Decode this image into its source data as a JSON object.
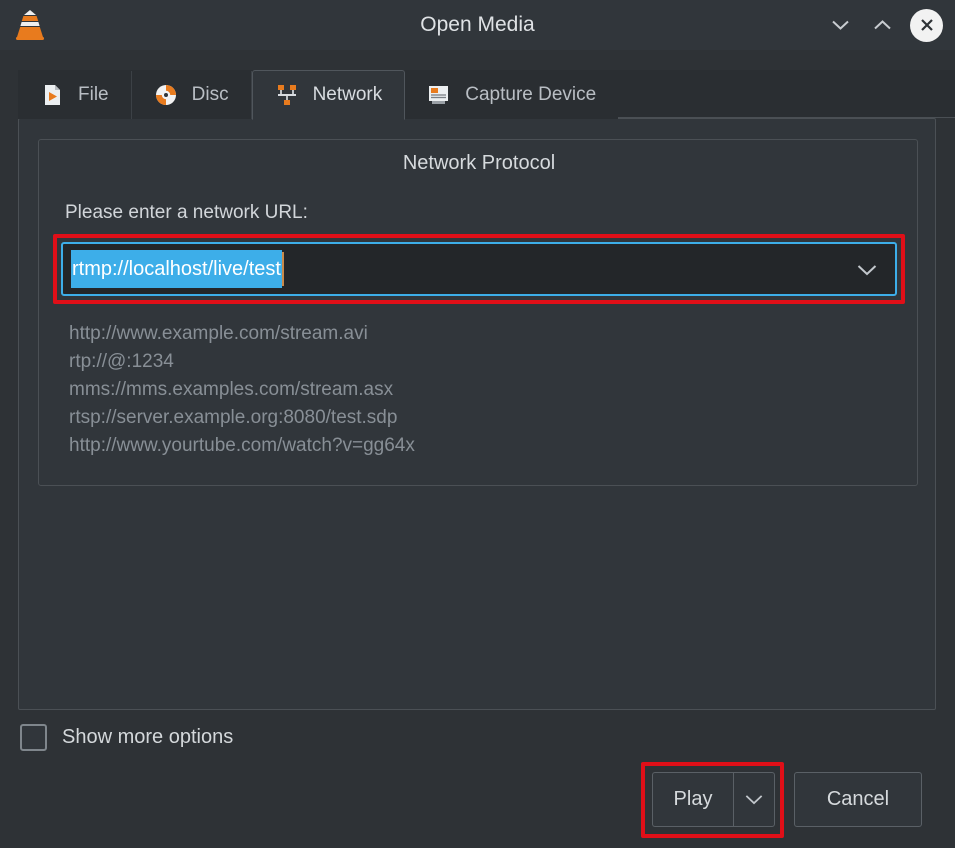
{
  "window": {
    "title": "Open Media",
    "logo_icon": "vlc-cone-icon",
    "controls": {
      "minimize_icon": "chevron-down-icon",
      "maximize_icon": "chevron-up-icon",
      "close_icon": "close-x-icon"
    }
  },
  "tabs": [
    {
      "label": "File",
      "icon": "file-play-icon",
      "active": false
    },
    {
      "label": "Disc",
      "icon": "disc-icon",
      "active": false
    },
    {
      "label": "Network",
      "icon": "network-topology-icon",
      "active": true
    },
    {
      "label": "Capture Device",
      "icon": "capture-card-icon",
      "active": false
    }
  ],
  "network_panel": {
    "group_title": "Network Protocol",
    "field_label": "Please enter a network URL:",
    "url_value": "rtmp://localhost/live/test",
    "url_selected": true,
    "dropdown_icon": "chevron-down-icon",
    "examples": [
      "http://www.example.com/stream.avi",
      "rtp://@:1234",
      "mms://mms.examples.com/stream.asx",
      "rtsp://server.example.org:8080/test.sdp",
      "http://www.yourtube.com/watch?v=gg64x"
    ]
  },
  "footer": {
    "show_more_label": "Show more options",
    "show_more_checked": false,
    "play_label": "Play",
    "play_menu_icon": "chevron-down-icon",
    "cancel_label": "Cancel"
  },
  "colors": {
    "window_bg": "#2e3236",
    "panel_bg": "#31363b",
    "tab_inactive_bg": "#2a2e32",
    "input_bg": "#232629",
    "focus_blue": "#3daee9",
    "selection_blue": "#3daee9",
    "annotation_red": "#e00f18",
    "accent_orange": "#e87b1e",
    "muted_text": "#888f96"
  }
}
